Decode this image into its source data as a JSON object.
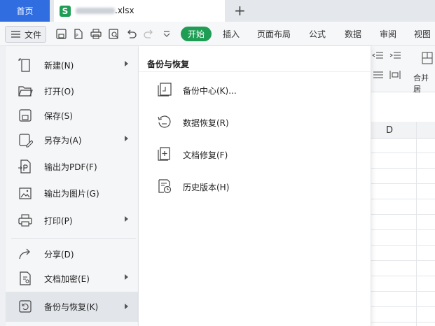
{
  "tabs": {
    "home": "首页",
    "document": ".xlsx",
    "new_tab": "+"
  },
  "toolbar": {
    "file_menu": "文件",
    "ribbon_tabs": [
      "开始",
      "插入",
      "页面布局",
      "公式",
      "数据",
      "审阅",
      "视图"
    ]
  },
  "sheet": {
    "merge_label": "合并居",
    "column_d": "D"
  },
  "file_menu": {
    "items": [
      {
        "label": "新建(N)",
        "icon": "new-file-icon",
        "submenu": true
      },
      {
        "label": "打开(O)",
        "icon": "folder-open-icon",
        "submenu": false
      },
      {
        "label": "保存(S)",
        "icon": "save-icon",
        "submenu": false
      },
      {
        "label": "另存为(A)",
        "icon": "save-as-icon",
        "submenu": true
      },
      {
        "label": "输出为PDF(F)",
        "icon": "pdf-export-icon",
        "submenu": false
      },
      {
        "label": "输出为图片(G)",
        "icon": "image-export-icon",
        "submenu": false
      },
      {
        "label": "打印(P)",
        "icon": "print-icon",
        "submenu": true
      },
      {
        "label": "分享(D)",
        "icon": "share-icon",
        "submenu": false
      },
      {
        "label": "文档加密(E)",
        "icon": "encrypt-icon",
        "submenu": true
      },
      {
        "label": "备份与恢复(K)",
        "icon": "backup-restore-icon",
        "submenu": true
      }
    ]
  },
  "submenu": {
    "title": "备份与恢复",
    "items": [
      {
        "label": "备份中心(K)...",
        "icon": "backup-center-icon"
      },
      {
        "label": "数据恢复(R)",
        "icon": "data-recovery-icon"
      },
      {
        "label": "文档修复(F)",
        "icon": "document-repair-icon"
      },
      {
        "label": "历史版本(H)",
        "icon": "history-version-icon"
      }
    ]
  },
  "colors": {
    "home_tab": "#2f6de1",
    "accent_green": "#1f9d55",
    "unsaved_dot": "#f0a020"
  }
}
